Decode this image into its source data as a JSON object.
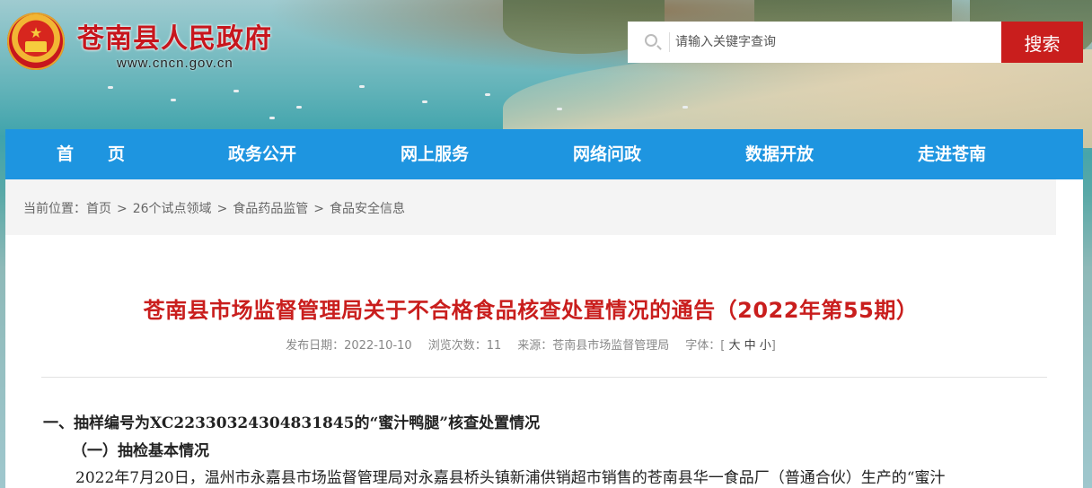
{
  "header": {
    "site_title": "苍南县人民政府",
    "site_url": "www.cncn.gov.cn",
    "search_placeholder": "请输入关键字查询",
    "search_button": "搜索"
  },
  "nav": {
    "items": [
      "首　　页",
      "政务公开",
      "网上服务",
      "网络问政",
      "数据开放",
      "走进苍南"
    ]
  },
  "breadcrumb": {
    "label": "当前位置：",
    "items": [
      "首页",
      "26个试点领域",
      "食品药品监管",
      "食品安全信息"
    ],
    "separator": ">"
  },
  "article": {
    "title": "苍南县市场监督管理局关于不合格食品核查处置情况的通告（2022年第55期）",
    "meta": {
      "date": "发布日期：2022-10-10",
      "views": "浏览次数：11",
      "source": "来源：苍南县市场监督管理局",
      "font_label": "字体：[",
      "font_large": "大",
      "font_medium": "中",
      "font_small": "小",
      "font_close": "]"
    },
    "heading1": "一、抽样编号为XC22330324304831845的“蜜汁鸭腿”核查处置情况",
    "heading2": "（一）抽检基本情况",
    "paragraph": "2022年7月20日，温州市永嘉县市场监督管理局对永嘉县桥头镇新浦供销超市销售的苍南县华一食品厂（普通合伙）生产的“蜜汁"
  },
  "colors": {
    "brand_red": "#c91e1d",
    "nav_blue": "#1e95e0"
  }
}
